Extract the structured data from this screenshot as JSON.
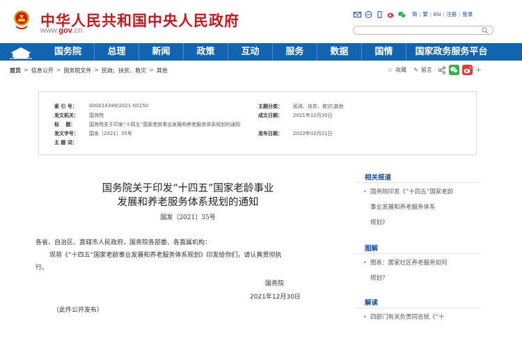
{
  "header": {
    "site_title": "中华人民共和国中央人民政府",
    "domain_prefix": "www.",
    "domain_main": "gov",
    "domain_suffix": ".cn",
    "links": [
      "简",
      "繁",
      "EN",
      "注册",
      "登录"
    ],
    "search_placeholder": ""
  },
  "nav": {
    "items": [
      "国务院",
      "总理",
      "新闻",
      "政策",
      "互动",
      "服务",
      "数据",
      "国情",
      "国家政务服务平台"
    ]
  },
  "breadcrumb": {
    "items": [
      "首页",
      "信息公开",
      "国务院文件",
      "民政、扶贫、救灾",
      "其他"
    ],
    "separator": ">"
  },
  "share": {
    "favorite": "收藏",
    "comment": "留言",
    "plus": "+"
  },
  "meta": {
    "index_label": "索 引 号：",
    "index_value": "000014349/2021-00150",
    "category_label": "主题分类：",
    "category_value": "民政、扶贫、救灾\\其他",
    "issuer_label": "发文机关：",
    "issuer_value": "国务院",
    "date_label": "成文日期：",
    "date_value": "2021年12月30日",
    "title_label": "标　 题：",
    "title_value": "国务院关于印发“十四五”国家老龄事业发展和养老服务体系规划的通知",
    "doc_no_label": "发文字号：",
    "doc_no_value": "国发〔2021〕35号",
    "publish_label": "发布日期：",
    "publish_value": "2022年02月21日",
    "keywords_label": "主 题 词："
  },
  "article": {
    "title_line1": "国务院关于印发“十四五”国家老龄事业",
    "title_line2": "发展和养老服务体系规划的通知",
    "doc_number": "国发〔2021〕35号",
    "addressee": "各省、自治区、直辖市人民政府，国务院各部委、各直属机构：",
    "body_line1": "现将《“十四五”国家老龄事业发展和养老服务体系规划》印发给你们，请认真贯彻执",
    "body_line2": "行。",
    "signer": "国务院",
    "sign_date": "2021年12月30日",
    "note": "（此件公开发布）"
  },
  "sidebar": {
    "related_title": "相关报道",
    "related_lines": [
      "国务院印发《“十四五”国家老龄",
      "事业发展和养老服务体系",
      "规划》"
    ],
    "illustration_title": "图解",
    "illustration_lines": [
      "图表：居家社区养老服务如何",
      "规划？"
    ],
    "interpretation_title": "解读",
    "interpretation_lines": [
      "四部门有关负责同志就《“十"
    ],
    "bullet": "•"
  },
  "colors": {
    "brand_red": "#c8161d",
    "nav_blue": "#1264b0",
    "link_blue": "#1a4c9b"
  }
}
